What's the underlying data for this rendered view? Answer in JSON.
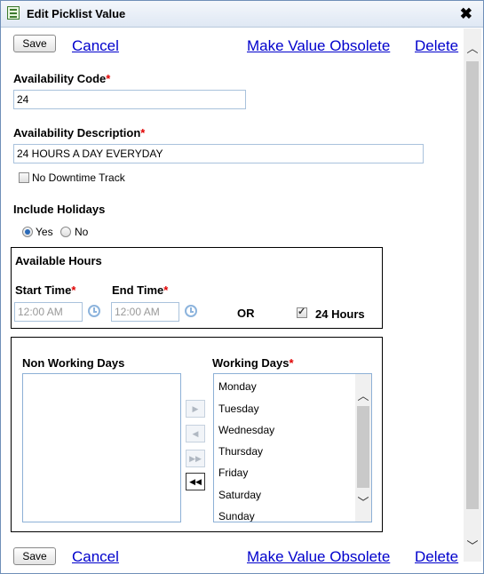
{
  "window": {
    "title": "Edit Picklist Value",
    "close_symbol": "✖"
  },
  "toolbar": {
    "save_label": "Save",
    "cancel_label": "Cancel",
    "obsolete_label": "Make Value Obsolete",
    "delete_label": "Delete"
  },
  "form": {
    "availability_code": {
      "label": "Availability Code",
      "value": "24"
    },
    "availability_description": {
      "label": "Availability Description",
      "value": "24 HOURS A DAY EVERYDAY"
    },
    "no_downtime_track": {
      "label": "No Downtime Track",
      "checked": false
    },
    "include_holidays": {
      "label": "Include Holidays",
      "yes_label": "Yes",
      "no_label": "No",
      "selected": "Yes"
    },
    "required_mark": "*"
  },
  "available_hours": {
    "title": "Available Hours",
    "start_time": {
      "label": "Start Time",
      "value": "12:00 AM"
    },
    "end_time": {
      "label": "End Time",
      "value": "12:00 AM"
    },
    "or_label": "OR",
    "hours24": {
      "label": "24 Hours",
      "checked": true
    }
  },
  "days": {
    "non_working_label": "Non Working Days",
    "working_label": "Working Days",
    "non_working": [],
    "working": [
      "Monday",
      "Tuesday",
      "Wednesday",
      "Thursday",
      "Friday",
      "Saturday",
      "Sunday"
    ],
    "move_right": "▶",
    "move_left": "◀",
    "move_all_right": "▶▶",
    "move_all_left": "◀◀"
  },
  "colors": {
    "link": "#0000cc",
    "required": "#e00000",
    "radio_selected": "#2a6ab8"
  }
}
